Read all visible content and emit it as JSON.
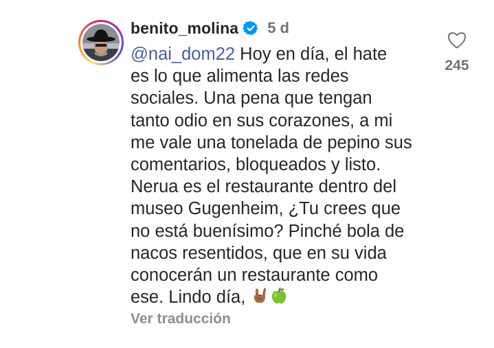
{
  "comment": {
    "username": "benito_molina",
    "verified": true,
    "time": "5 d",
    "mention": "@nai_dom22",
    "lines": [
      " Hoy en día, el hate",
      "es lo que alimenta las redes",
      "sociales. Una pena que tengan",
      "tanto odio en sus corazones, a mi",
      "me vale una tonelada de pepino sus",
      "comentarios, bloqueados y listo.",
      "Nerua es el restaurante dentro del",
      "museo Gugenheim, ¿Tu crees que",
      "no está buenísimo? Pinché bola de",
      "nacos resentidos, que en su vida",
      "conocerán un restaurante como",
      "ese. Lindo día, "
    ],
    "emojis": [
      "sign-of-the-horns-emoji",
      "green-apple-emoji"
    ],
    "translate_label": "Ver traducción",
    "like_count": "245"
  },
  "colors": {
    "text": "#262626",
    "mention": "#4a5d9e",
    "muted": "#737373",
    "verified": "#0095f6"
  },
  "icons": {
    "verified": "verified-badge-icon",
    "like": "heart-outline-icon"
  }
}
